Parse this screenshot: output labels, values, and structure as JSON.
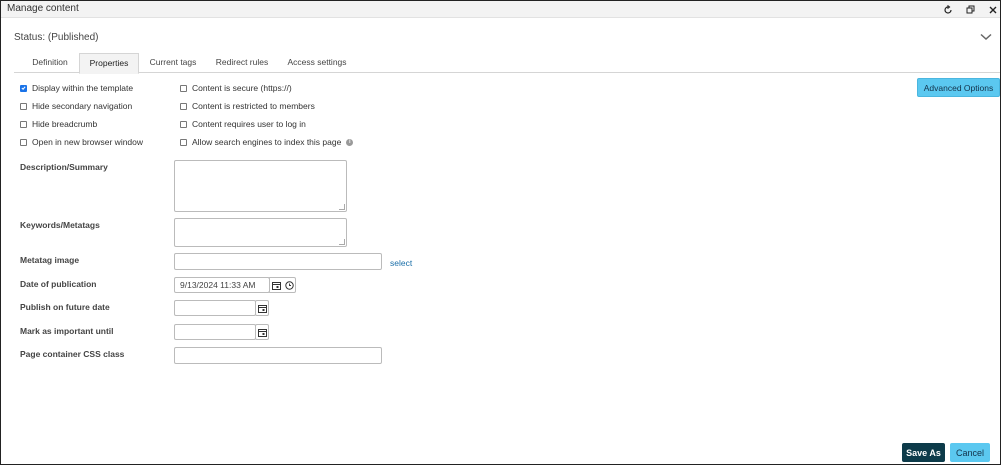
{
  "window": {
    "title": "Manage content"
  },
  "status": {
    "text": "Status: (Published)"
  },
  "tabs": [
    {
      "label": "Definition"
    },
    {
      "label": "Properties",
      "active": true
    },
    {
      "label": "Current tags"
    },
    {
      "label": "Redirect rules"
    },
    {
      "label": "Access settings"
    }
  ],
  "options_left": [
    {
      "label": "Display within the template",
      "checked": true
    },
    {
      "label": "Hide secondary navigation",
      "checked": false
    },
    {
      "label": "Hide breadcrumb",
      "checked": false
    },
    {
      "label": "Open in new browser window",
      "checked": false
    }
  ],
  "options_right": [
    {
      "label": "Content is secure (https://)",
      "checked": false
    },
    {
      "label": "Content is restricted to members",
      "checked": false
    },
    {
      "label": "Content requires user to log in",
      "checked": false
    },
    {
      "label": "Allow search engines to index this page",
      "checked": false
    }
  ],
  "advanced_button": "Advanced Options",
  "fields": {
    "description": {
      "label": "Description/Summary",
      "value": ""
    },
    "keywords": {
      "label": "Keywords/Metatags",
      "value": ""
    },
    "metatag_image": {
      "label": "Metatag image",
      "value": "",
      "link": "select"
    },
    "date_publication": {
      "label": "Date of publication",
      "value": "9/13/2024 11:33 AM"
    },
    "publish_future": {
      "label": "Publish on future date",
      "value": ""
    },
    "mark_important": {
      "label": "Mark as important until",
      "value": ""
    },
    "css_class": {
      "label": "Page container CSS class",
      "value": ""
    }
  },
  "footer": {
    "save_as": "Save As",
    "cancel": "Cancel"
  },
  "colors": {
    "primary_button": "#0d3b4a",
    "accent": "#5bc8f0",
    "link": "#1a6ea8"
  }
}
